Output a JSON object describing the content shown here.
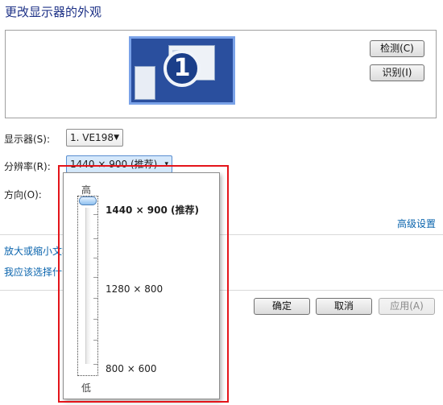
{
  "page_title": "更改显示器的外观",
  "preview": {
    "monitor_number": "1"
  },
  "buttons": {
    "detect": "检测(C)",
    "identify": "识别(I)",
    "ok": "确定",
    "cancel": "取消",
    "apply": "应用(A)"
  },
  "display": {
    "label": "显示器(S):",
    "value": "1. VE198"
  },
  "resolution": {
    "label": "分辨率(R):",
    "value": "1440 × 900 (推荐)",
    "dropdown": {
      "high_label": "高",
      "low_label": "低",
      "options": [
        "1440 × 900 (推荐)",
        "1280 × 800",
        "800 × 600"
      ],
      "selected_index": 0
    }
  },
  "orientation": {
    "label": "方向(O):"
  },
  "links": {
    "advanced": "高级设置",
    "text_size": "放大或缩小文本",
    "which_choose": "我应该选择什么"
  },
  "colors": {
    "title": "#1e3287",
    "link": "#0a64ad",
    "highlight_border": "#e4141a"
  }
}
